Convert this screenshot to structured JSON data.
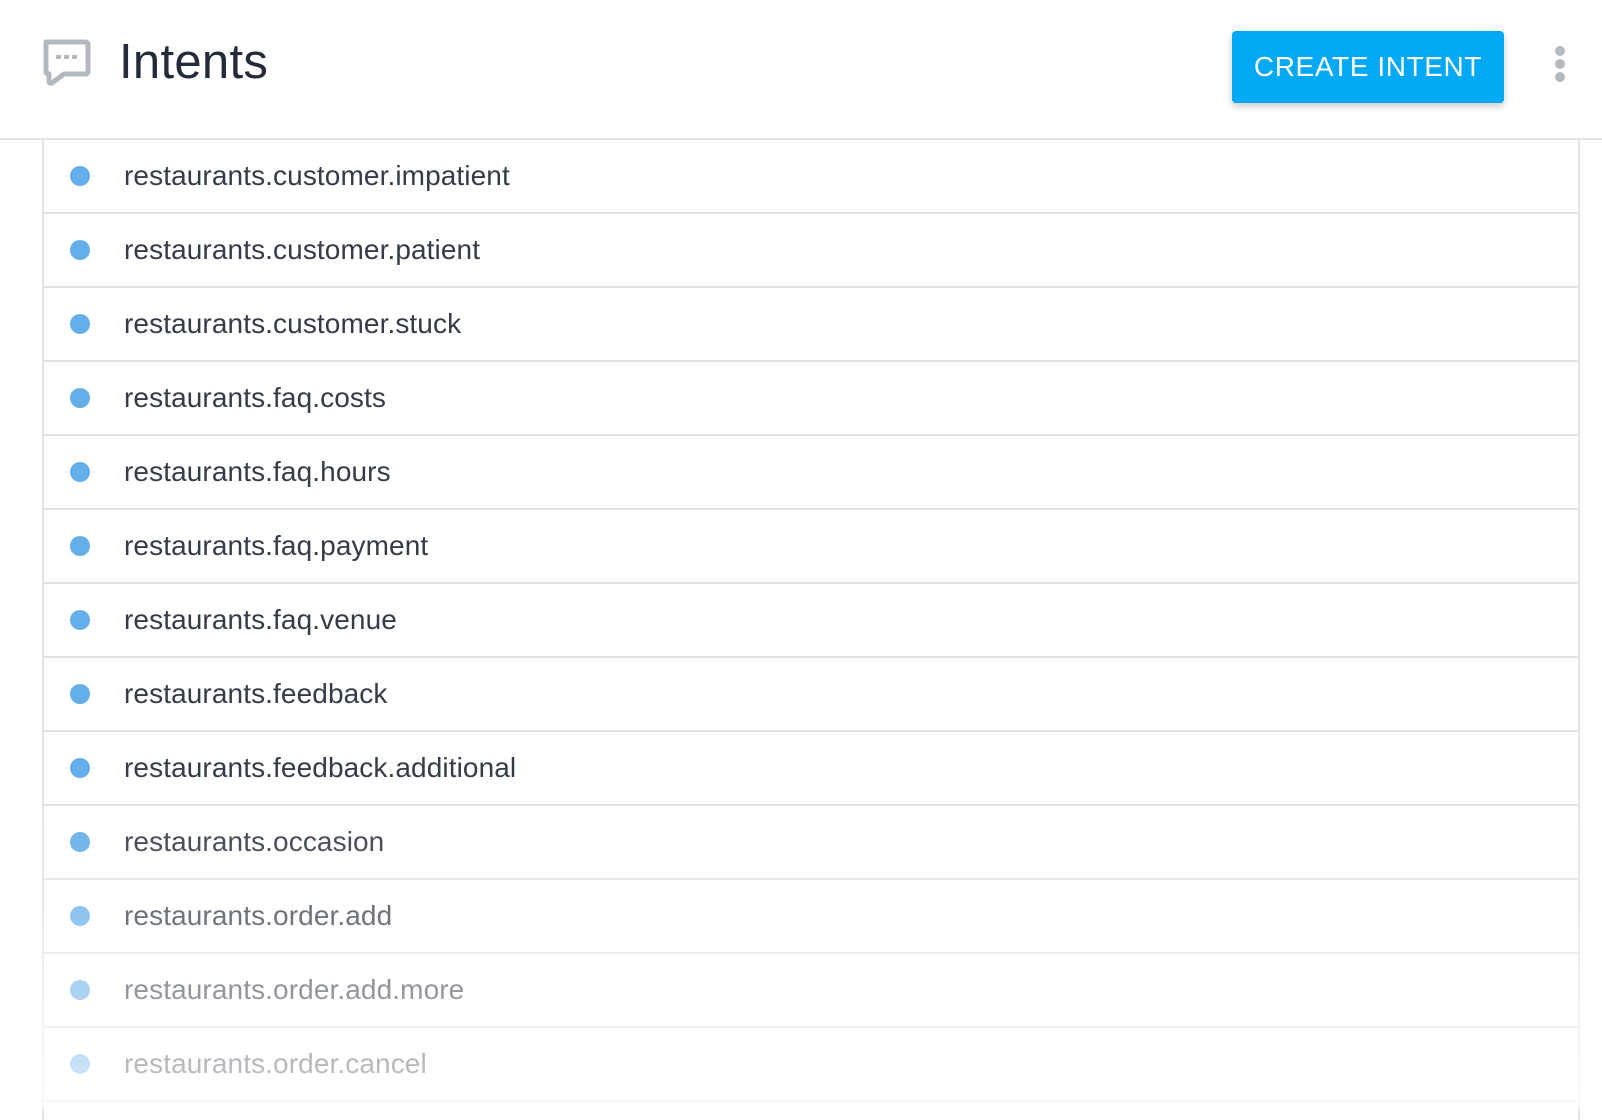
{
  "header": {
    "icon": "chat-bubble-icon",
    "title": "Intents",
    "create_button_label": "CREATE INTENT",
    "more_menu_icon": "more-vert-icon"
  },
  "colors": {
    "accent": "#03a9f4",
    "bullet": "#64aee9",
    "title_text": "#232a3a",
    "item_text": "#353b48",
    "icon_gray": "#b4b8bf",
    "divider": "#e3e3e3"
  },
  "intents": [
    {
      "label": "restaurants.customer.impatient",
      "icon": "bullet-dot-icon"
    },
    {
      "label": "restaurants.customer.patient",
      "icon": "bullet-dot-icon"
    },
    {
      "label": "restaurants.customer.stuck",
      "icon": "bullet-dot-icon"
    },
    {
      "label": "restaurants.faq.costs",
      "icon": "bullet-dot-icon"
    },
    {
      "label": "restaurants.faq.hours",
      "icon": "bullet-dot-icon"
    },
    {
      "label": "restaurants.faq.payment",
      "icon": "bullet-dot-icon"
    },
    {
      "label": "restaurants.faq.venue",
      "icon": "bullet-dot-icon"
    },
    {
      "label": "restaurants.feedback",
      "icon": "bullet-dot-icon"
    },
    {
      "label": "restaurants.feedback.additional",
      "icon": "bullet-dot-icon"
    },
    {
      "label": "restaurants.occasion",
      "icon": "bullet-dot-icon"
    },
    {
      "label": "restaurants.order.add",
      "icon": "bullet-dot-icon"
    },
    {
      "label": "restaurants.order.add.more",
      "icon": "bullet-dot-icon"
    },
    {
      "label": "restaurants.order.cancel",
      "icon": "bullet-dot-icon"
    }
  ]
}
